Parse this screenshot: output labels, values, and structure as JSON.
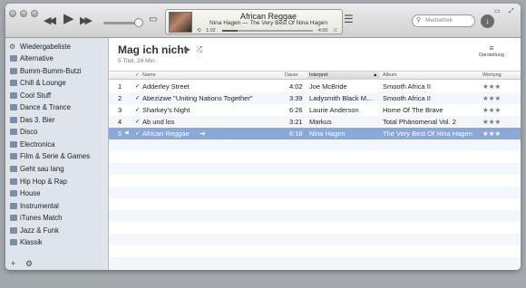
{
  "window": {
    "controls": [
      "close",
      "minimize",
      "zoom"
    ],
    "right_icons": [
      "miniplayer-icon",
      "fullscreen-icon"
    ]
  },
  "player": {
    "prev": "◀◀",
    "play": "▶",
    "next": "▶▶",
    "airplay": "▭",
    "now_playing_title": "African Reggae",
    "now_playing_subtitle": "Nina Hagen — The Very Best Of Nina Hagen",
    "elapsed": "1:02",
    "remaining": "-4:55",
    "progress_fraction": 0.17,
    "volume_fraction": 0.85
  },
  "search": {
    "placeholder": "Mediathek"
  },
  "sidebar": {
    "header": "Wiedergabeliste",
    "items": [
      {
        "label": "Alternative"
      },
      {
        "label": "Bumm-Bumm-Butzi"
      },
      {
        "label": "Chill & Lounge"
      },
      {
        "label": "Cool Stuff"
      },
      {
        "label": "Dance & Trance"
      },
      {
        "label": "Das 3. Bier"
      },
      {
        "label": "Disco"
      },
      {
        "label": "Electronica"
      },
      {
        "label": "Film & Serie & Games"
      },
      {
        "label": "Geht sau lang"
      },
      {
        "label": "Hip Hop & Rap"
      },
      {
        "label": "House"
      },
      {
        "label": "Instrumental"
      },
      {
        "label": "iTunes Match"
      },
      {
        "label": "Jazz & Funk"
      },
      {
        "label": "Klassik"
      }
    ],
    "add_icon": "+",
    "gear_icon": "⚙"
  },
  "playlist": {
    "title": "Mag ich nicht",
    "subtitle": "5 Titel, 24 Min.",
    "view_label": "Darstellung"
  },
  "table": {
    "headers": {
      "check": "✓",
      "name": "Name",
      "time": "Dauer",
      "artist": "Interpret",
      "album": "Album",
      "rating": "Wertung"
    },
    "rows": [
      {
        "num": "1",
        "name": "Adderley Street",
        "time": "4:02",
        "artist": "Joe McBride",
        "album": "Smooth Africa II",
        "rating": "★★★"
      },
      {
        "num": "2",
        "name": "Abezizwe \"Uniting Nations Together\"",
        "time": "3:39",
        "artist": "Ladysmith Black M…",
        "album": "Smooth Africa II",
        "rating": "★★★"
      },
      {
        "num": "3",
        "name": "Sharkey's Night",
        "time": "6:26",
        "artist": "Laurie Anderson",
        "album": "Home Of The Brave",
        "rating": "★★★"
      },
      {
        "num": "4",
        "name": "Ab und los",
        "time": "3:21",
        "artist": "Markus",
        "album": "Total Phänomenal Vol. 2",
        "rating": "★★★"
      },
      {
        "num": "5",
        "name": "African Reggae",
        "time": "6:18",
        "artist": "Nina Hagen",
        "album": "The Very Best Of Nina Hagen",
        "rating": "★★★",
        "selected": true
      }
    ]
  },
  "colors": {
    "selection": "#8aa8d8",
    "sidebar_bg": "#dee4ea"
  }
}
